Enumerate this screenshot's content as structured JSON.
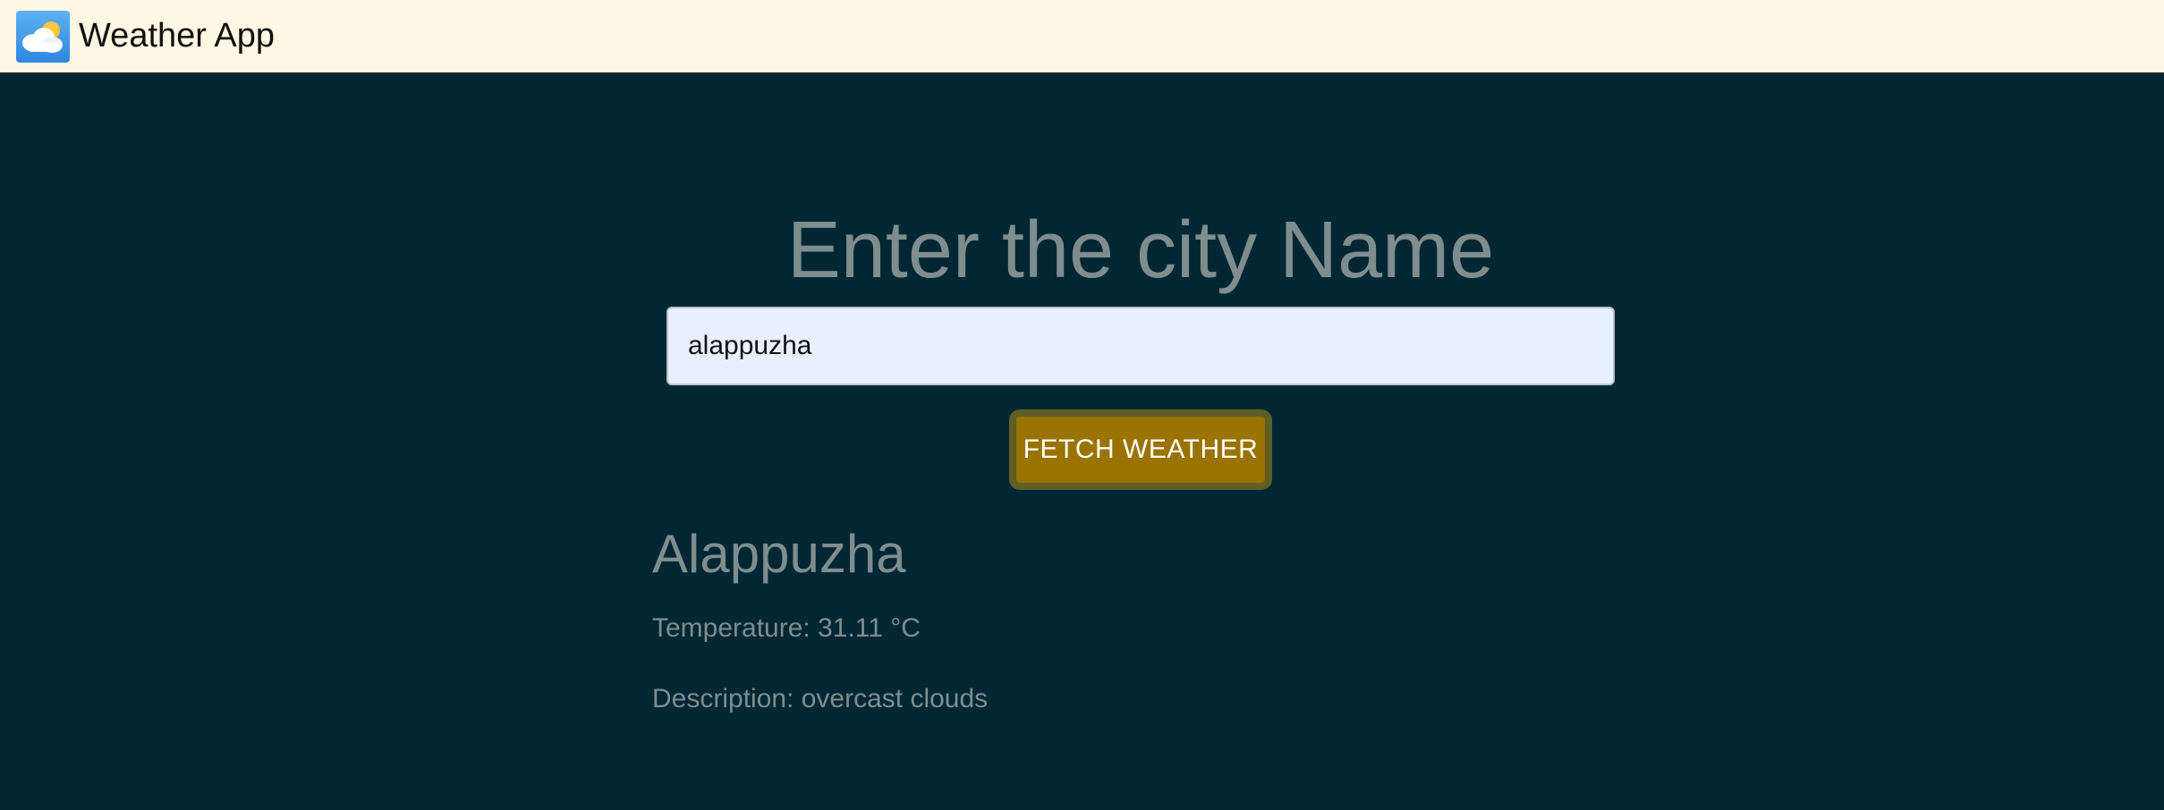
{
  "navbar": {
    "title": "Weather App",
    "icon": "weather-cloud-sun-icon"
  },
  "main": {
    "heading": "Enter the city Name",
    "city_input": {
      "value": "alappuzha",
      "placeholder": ""
    },
    "fetch_button_label": "FETCH WEATHER",
    "result": {
      "city": "Alappuzha",
      "temperature": "Temperature: 31.11 °C",
      "description": "Description: overcast clouds"
    }
  },
  "colors": {
    "navbar_bg": "#fff7e3",
    "page_bg": "#002733",
    "button_bg": "#9a7300",
    "muted_text": "#7f8d8f"
  }
}
